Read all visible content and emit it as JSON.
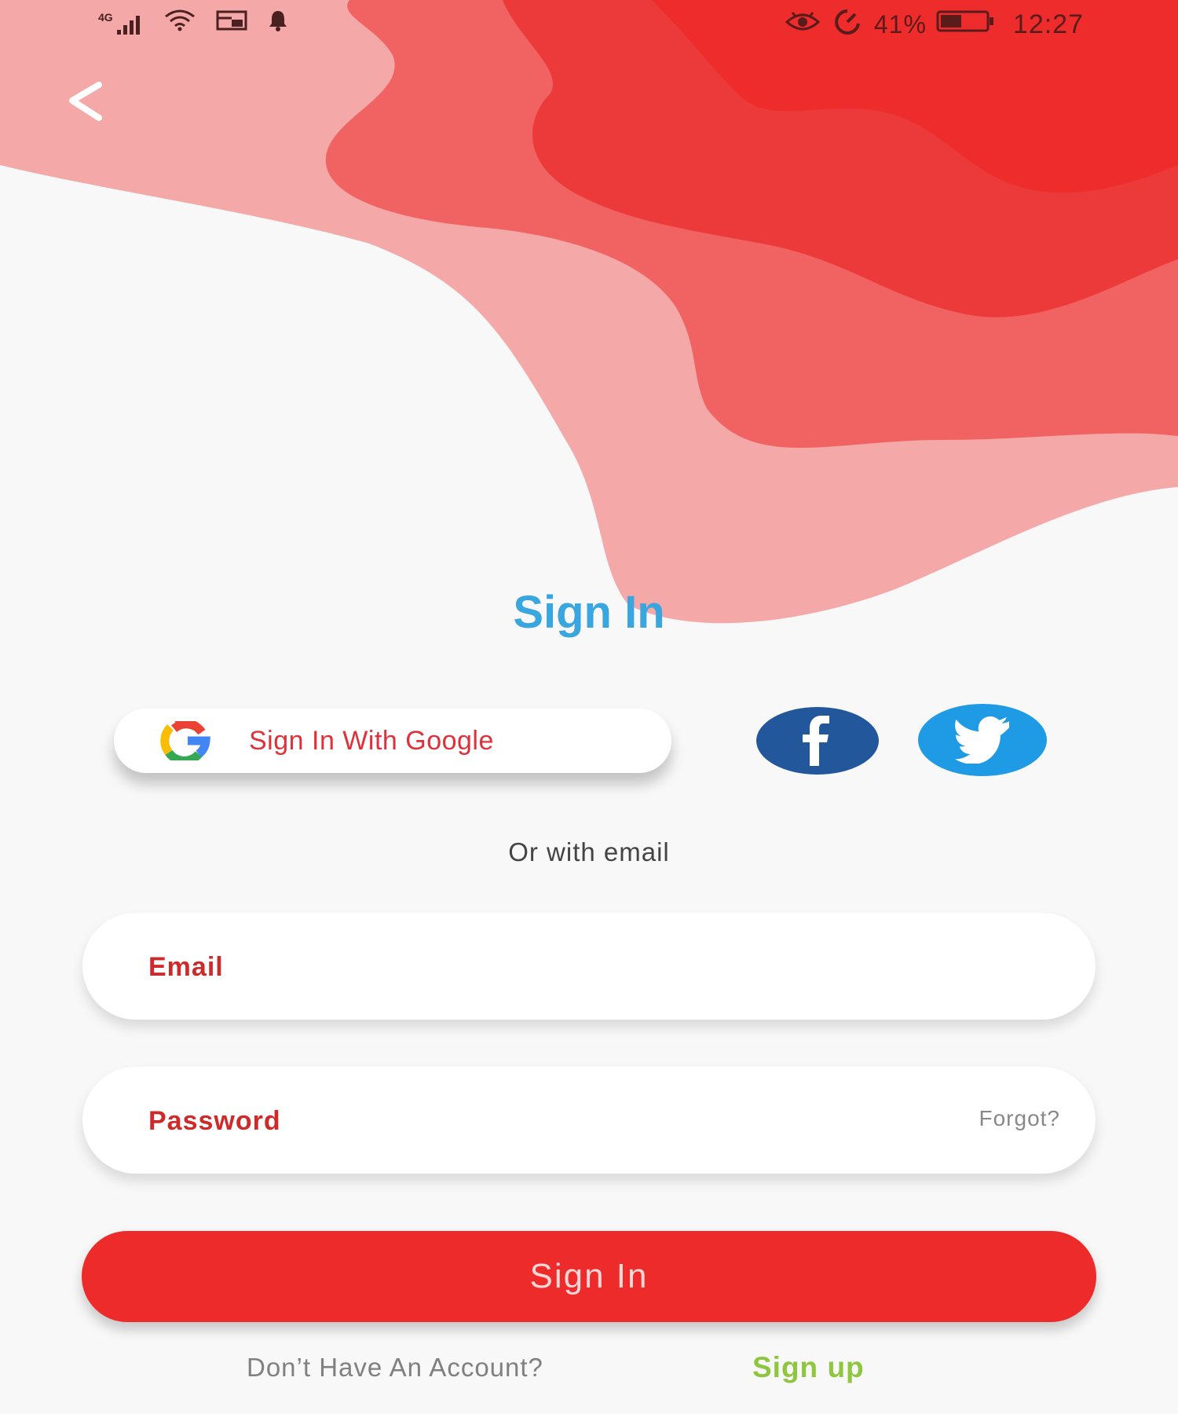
{
  "status_bar": {
    "network": "4G",
    "battery_percent": "41%",
    "time": "12:27",
    "icons": [
      "signal-icon",
      "wifi-icon",
      "cast-icon",
      "notification-bell-icon",
      "eye-icon",
      "data-saver-icon",
      "battery-icon"
    ]
  },
  "header": {
    "back_icon": "chevron-left-icon",
    "title": "Sign In"
  },
  "social": {
    "google_label": "Sign In With Google",
    "google_icon": "google-icon",
    "facebook_icon": "facebook-icon",
    "twitter_icon": "twitter-icon"
  },
  "divider_text": "Or with email",
  "form": {
    "email_placeholder": "Email",
    "password_placeholder": "Password",
    "forgot_label": "Forgot?",
    "submit_label": "Sign In"
  },
  "footer": {
    "prompt": "Don’t Have An Account?",
    "signup_label": "Sign up"
  },
  "colors": {
    "accent_red": "#ee2b2b",
    "title_blue": "#3aa6df",
    "signup_green": "#8ec63f",
    "facebook_blue": "#23579b",
    "twitter_blue": "#1f9ae5"
  }
}
